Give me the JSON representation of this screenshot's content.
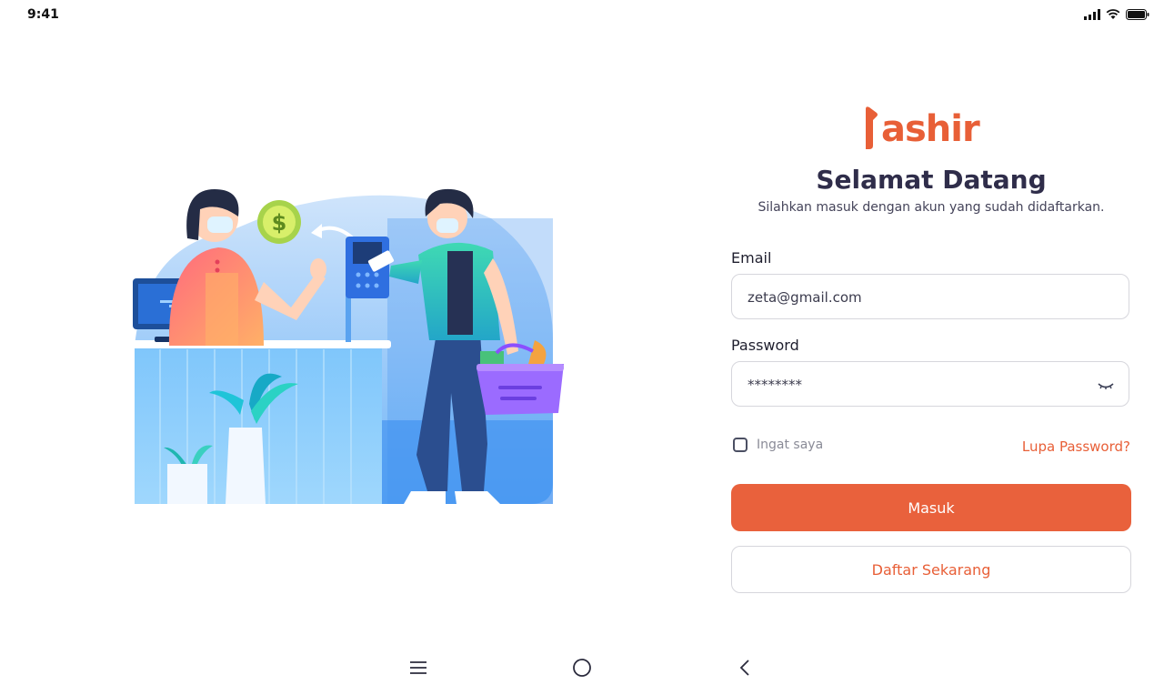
{
  "status": {
    "time": "9:41"
  },
  "brand": {
    "name": "kashir",
    "logo_text": "ashir",
    "color": "#e85f37"
  },
  "header": {
    "title": "Selamat Datang",
    "subtitle": "Silahkan masuk dengan akun yang sudah didaftarkan."
  },
  "form": {
    "email_label": "Email",
    "email_value": "zeta@gmail.com",
    "password_label": "Password",
    "password_value": "********",
    "remember_label": "Ingat saya",
    "remember_checked": false,
    "forgot_label": "Lupa Password?",
    "submit_label": "Masuk",
    "register_label": "Daftar Sekarang"
  },
  "icons": {
    "password_toggle": "eye-closed-icon",
    "nav": [
      "menu-icon",
      "home-circle-icon",
      "back-chevron-icon"
    ],
    "status": [
      "signal-icon",
      "wifi-icon",
      "battery-icon"
    ]
  },
  "colors": {
    "accent": "#e9613c",
    "title": "#2f2d4a",
    "border": "#d6d6dc"
  }
}
